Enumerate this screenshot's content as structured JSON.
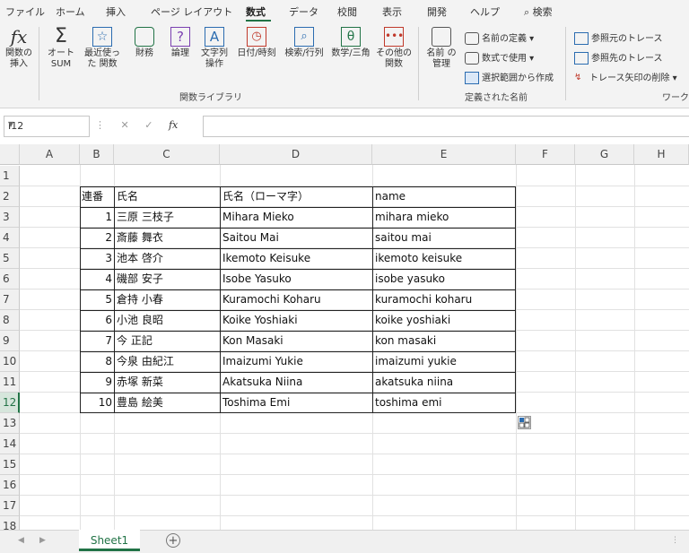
{
  "menu": {
    "tabs": [
      "ファイル",
      "ホーム",
      "挿入",
      "ページ レイアウト",
      "数式",
      "データ",
      "校閲",
      "表示",
      "開発",
      "ヘルプ"
    ],
    "active_tab": "数式",
    "search_label": "検索"
  },
  "ribbon": {
    "function_library": {
      "insert_function": "関数の 挿入",
      "autosum": "オート SUM",
      "recent": "最近使った 関数",
      "financial": "財務",
      "logical": "論理",
      "text": "文字列 操作",
      "datetime": "日付/時刻",
      "lookup": "検索/行列",
      "math": "数学/三角",
      "more": "その他の 関数",
      "group_label": "関数ライブラリ"
    },
    "defined_names": {
      "name_manager": "名前 の管理",
      "define_name": "名前の定義",
      "use_in_formula": "数式で使用",
      "create_from_selection": "選択範囲から作成",
      "group_label": "定義された名前"
    },
    "formula_auditing": {
      "trace_precedents": "参照元のトレース",
      "trace_dependents": "参照先のトレース",
      "remove_arrows": "トレース矢印の削除",
      "group_label": "ワークシ"
    }
  },
  "formula_bar": {
    "name_box": "I12",
    "fx": "fx",
    "formula": ""
  },
  "columns": [
    "A",
    "B",
    "C",
    "D",
    "E",
    "F",
    "G",
    "H"
  ],
  "rows": [
    "1",
    "2",
    "3",
    "4",
    "5",
    "6",
    "7",
    "8",
    "9",
    "10",
    "11",
    "12",
    "13",
    "14",
    "15",
    "16",
    "17",
    "18"
  ],
  "selected_row": "12",
  "table": {
    "headers": [
      "連番",
      "氏名",
      "氏名（ローマ字）",
      "name"
    ],
    "rows": [
      [
        "1",
        "三原 三枝子",
        "Mihara Mieko",
        "mihara mieko"
      ],
      [
        "2",
        "斎藤 舞衣",
        "Saitou Mai",
        "saitou mai"
      ],
      [
        "3",
        "池本 啓介",
        "Ikemoto Keisuke",
        "ikemoto keisuke"
      ],
      [
        "4",
        "磯部 安子",
        "Isobe Yasuko",
        "isobe yasuko"
      ],
      [
        "5",
        "倉持 小春",
        "Kuramochi Koharu",
        "kuramochi koharu"
      ],
      [
        "6",
        "小池 良昭",
        "Koike Yoshiaki",
        "koike yoshiaki"
      ],
      [
        "7",
        "今 正記",
        "Kon Masaki",
        "kon masaki"
      ],
      [
        "8",
        "今泉 由紀江",
        "Imaizumi Yukie",
        "imaizumi yukie"
      ],
      [
        "9",
        "赤塚 新菜",
        "Akatsuka Niina",
        "akatsuka niina"
      ],
      [
        "10",
        "豊島 絵美",
        "Toshima Emi",
        "toshima emi"
      ]
    ]
  },
  "sheet_tabs": {
    "active": "Sheet1",
    "add": "+"
  },
  "colors": {
    "accent": "#217346",
    "ribbon_bg": "#f3f3f3"
  }
}
